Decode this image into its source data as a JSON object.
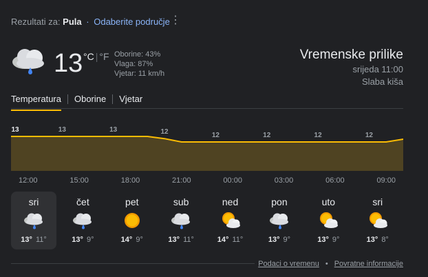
{
  "search": {
    "results_for_label": "Rezultati za:",
    "location": "Pula",
    "separator": "·",
    "change_area_link": "Odaberite područje"
  },
  "current": {
    "temperature": "13",
    "unit_c": "°C",
    "unit_sep": "|",
    "unit_f": "°F",
    "precipitation": "Oborine: 43%",
    "humidity": "Vlaga: 87%",
    "wind": "Vjetar: 11 km/h",
    "icon": "cloud-rain-icon"
  },
  "header": {
    "title": "Vremenske prilike",
    "datetime": "srijeda 11:00",
    "condition": "Slaba kiša"
  },
  "tabs": [
    "Temperatura",
    "Oborine",
    "Vjetar"
  ],
  "chart_data": {
    "type": "area",
    "x": [
      "11:00",
      "12:00",
      "13:00",
      "14:00",
      "15:00",
      "16:00",
      "17:00",
      "18:00",
      "19:00",
      "20:00",
      "21:00",
      "22:00",
      "23:00",
      "00:00",
      "01:00",
      "02:00",
      "03:00",
      "04:00",
      "05:00",
      "06:00",
      "07:00",
      "08:00",
      "09:00",
      "10:00"
    ],
    "values": [
      13,
      13,
      13,
      13,
      13,
      13,
      13,
      13,
      13,
      12.6,
      12,
      12,
      12,
      12,
      12,
      12,
      12,
      12,
      12,
      12,
      12,
      12,
      12,
      12.5
    ],
    "point_labels": [
      {
        "x": "11:00",
        "label": "13"
      },
      {
        "x": "14:00",
        "label": "13"
      },
      {
        "x": "17:00",
        "label": "13"
      },
      {
        "x": "20:00",
        "label": "12"
      },
      {
        "x": "23:00",
        "label": "12"
      },
      {
        "x": "02:00",
        "label": "12"
      },
      {
        "x": "05:00",
        "label": "12"
      },
      {
        "x": "08:00",
        "label": "12"
      }
    ],
    "tick_labels": [
      "12:00",
      "15:00",
      "18:00",
      "21:00",
      "00:00",
      "03:00",
      "06:00",
      "09:00"
    ],
    "line_color": "#fbbc04",
    "fill_color": "#4f4322"
  },
  "days": [
    {
      "name": "sri",
      "icon": "cloud-rain-icon",
      "high": "13°",
      "low": "11°",
      "selected": true
    },
    {
      "name": "čet",
      "icon": "cloud-rain-icon",
      "high": "13°",
      "low": "9°"
    },
    {
      "name": "pet",
      "icon": "sun-icon",
      "high": "14°",
      "low": "9°"
    },
    {
      "name": "sub",
      "icon": "cloud-rain-icon",
      "high": "13°",
      "low": "11°"
    },
    {
      "name": "ned",
      "icon": "partly-cloudy-icon",
      "high": "14°",
      "low": "11°"
    },
    {
      "name": "pon",
      "icon": "cloud-rain-icon",
      "high": "13°",
      "low": "9°"
    },
    {
      "name": "uto",
      "icon": "partly-cloudy-icon",
      "high": "13°",
      "low": "9°"
    },
    {
      "name": "sri",
      "icon": "partly-cloudy-icon",
      "high": "13°",
      "low": "8°"
    }
  ],
  "footer": {
    "data_link": "Podaci o vremenu",
    "bullet": "•",
    "feedback_link": "Povratne informacije"
  },
  "colors": {
    "accent": "#fbbc04",
    "link": "#8ab4f8",
    "background": "#202124"
  }
}
